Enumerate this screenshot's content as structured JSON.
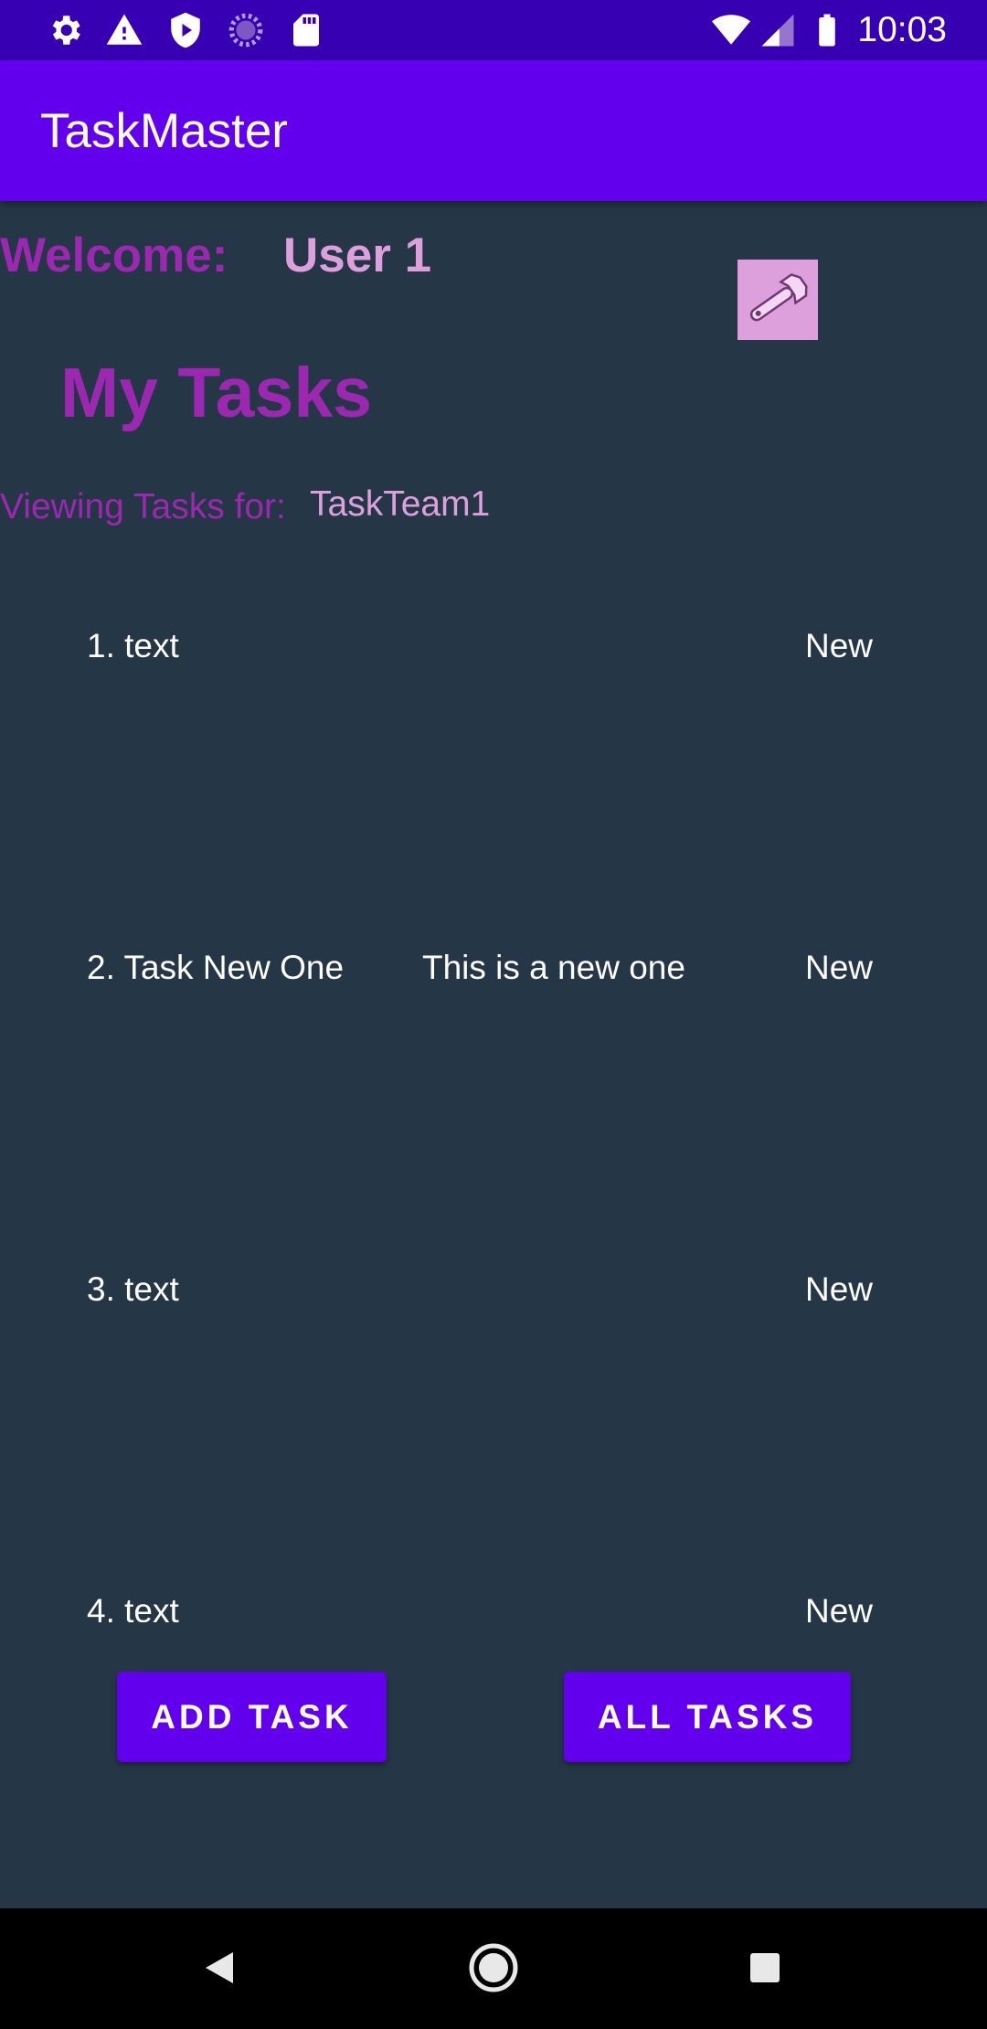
{
  "status_bar": {
    "time": "10:03",
    "left_icons": [
      "settings-icon",
      "warning-icon",
      "shield-icon",
      "loading-icon",
      "sd-card-icon"
    ],
    "right_icons": [
      "wifi-icon",
      "signal-icon",
      "battery-icon"
    ]
  },
  "app_bar": {
    "title": "TaskMaster"
  },
  "header": {
    "welcome_label": "Welcome:",
    "username": "User 1",
    "settings_icon": "wrench-icon",
    "page_title": "My Tasks",
    "team_label": "Viewing Tasks for:",
    "team_name": "TaskTeam1"
  },
  "tasks": [
    {
      "title": "1. text",
      "body": "",
      "state": "New"
    },
    {
      "title": "2. Task New One",
      "body": "This is a new one",
      "state": "New"
    },
    {
      "title": "3. text",
      "body": "",
      "state": "New"
    },
    {
      "title": "4. text",
      "body": "",
      "state": "New"
    }
  ],
  "buttons": {
    "add_task": "ADD TASK",
    "all_tasks": "ALL TASKS"
  },
  "nav_bar": {
    "icons": [
      "back-icon",
      "home-icon",
      "recents-icon"
    ]
  },
  "colors": {
    "status_bar": "#3700B3",
    "primary": "#6200EE",
    "background": "#253746",
    "purple_text": "#9C27B0",
    "plum_text": "#DDA0DD"
  }
}
